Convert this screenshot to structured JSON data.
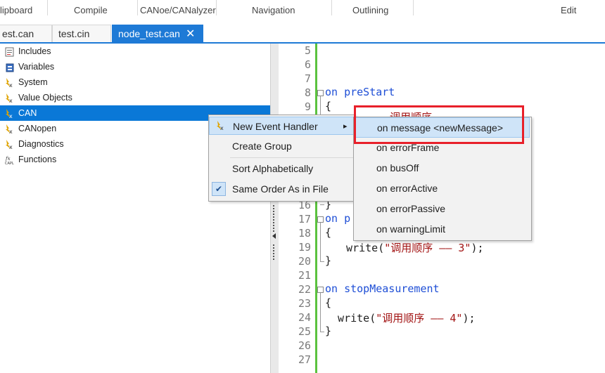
{
  "ribbon": {
    "groups": [
      "lipboard",
      "Compile",
      "CANoe/CANalyzer",
      "Navigation",
      "Outlining",
      "Edit"
    ]
  },
  "tabs": [
    {
      "label": "est.can"
    },
    {
      "label": "test.cin"
    },
    {
      "label": "node_test.can",
      "close": "✕"
    }
  ],
  "tree": {
    "items": [
      {
        "label": "Includes",
        "icon": "includes-icon"
      },
      {
        "label": "Variables",
        "icon": "variables-icon"
      },
      {
        "label": "System",
        "icon": "event-handler-icon"
      },
      {
        "label": "Value Objects",
        "icon": "event-handler-icon"
      },
      {
        "label": "CAN",
        "icon": "event-handler-icon",
        "selected": true
      },
      {
        "label": "CANopen",
        "icon": "event-handler-icon"
      },
      {
        "label": "Diagnostics",
        "icon": "event-handler-icon"
      },
      {
        "label": "Functions",
        "icon": "function-icon"
      }
    ]
  },
  "context_menu": {
    "items": [
      {
        "label": "New Event Handler",
        "arrow": "▸"
      },
      {
        "label": "Create Group"
      },
      {
        "label": "Sort Alphabetically"
      },
      {
        "label": "Same Order As in File",
        "check": "✔"
      }
    ]
  },
  "submenu": {
    "items": [
      {
        "label": "on message <newMessage>"
      },
      {
        "label": "on errorFrame"
      },
      {
        "label": "on busOff"
      },
      {
        "label": "on errorActive"
      },
      {
        "label": "on errorPassive"
      },
      {
        "label": "on warningLimit"
      }
    ]
  },
  "editor": {
    "line_numbers": [
      "5",
      "6",
      "7",
      "8",
      "9",
      "16",
      "17",
      "18",
      "19",
      "20",
      "21",
      "22",
      "23",
      "24",
      "25",
      "26",
      "27"
    ],
    "code": {
      "l8_kw": "on",
      "l8_rest": " preStart",
      "l9": "{",
      "l9_partial": "  调用顺序",
      "l16": "}",
      "l17_kw": "on",
      "l17_rest": " p",
      "l18": "{",
      "l19_fn": "  write(",
      "l19_str": "\"调用顺序 —— 3\"",
      "l19_end": ");",
      "l20": "}",
      "l22_kw": "on",
      "l22_rest": " stopMeasurement",
      "l23": "{",
      "l24_fn": "  write(",
      "l24_str": "\"调用顺序 —— 4\"",
      "l24_end": ");",
      "l25": "}"
    }
  },
  "colors": {
    "accent": "#1e7ad6",
    "selection": "#0a78d7",
    "highlight_box": "#e8202a",
    "keyword": "#1f4fd6",
    "string": "#a31515",
    "changebar": "#5bc23f"
  }
}
